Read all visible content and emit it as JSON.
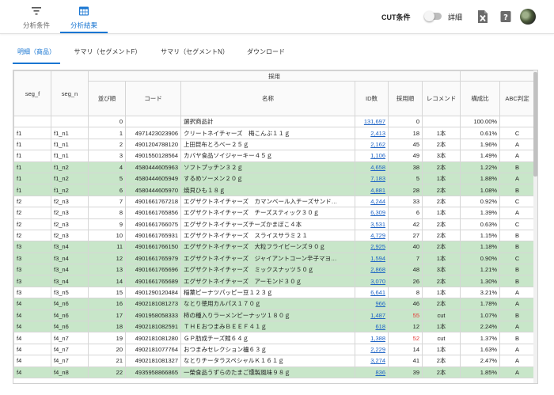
{
  "nav": {
    "cond_label": "分析条件",
    "result_label": "分析結果"
  },
  "header": {
    "cut_label": "CUT条件",
    "detail_label": "詳細"
  },
  "subtabs": [
    "明細（商品）",
    "サマリ（セグメントF）",
    "サマリ（セグメントN）",
    "ダウンロード"
  ],
  "table": {
    "group_header": "採用",
    "columns": [
      "seg_f",
      "seg_n",
      "並び順",
      "コード",
      "名称",
      "ID数",
      "採用順",
      "レコメンド",
      "構成比",
      "ABC判定"
    ],
    "rows": [
      {
        "seg_f": "",
        "seg_n": "",
        "order": "0",
        "code": "",
        "name": "選択商品計",
        "ids": "131,697",
        "rank": "0",
        "rec": "",
        "ratio": "100.00%",
        "abc": "",
        "green": false,
        "red_rank": false
      },
      {
        "seg_f": "f1",
        "seg_n": "f1_n1",
        "order": "1",
        "code": "4971423023906",
        "name": "クリートネイチャーズ　梅こんぶ１１ｇ",
        "ids": "2,413",
        "rank": "18",
        "rec": "1本",
        "ratio": "0.61%",
        "abc": "C",
        "green": false,
        "red_rank": false
      },
      {
        "seg_f": "f1",
        "seg_n": "f1_n1",
        "order": "2",
        "code": "4901204788120",
        "name": "上田昆布とろべー２５ｇ",
        "ids": "2,162",
        "rank": "45",
        "rec": "2本",
        "ratio": "1.96%",
        "abc": "A",
        "green": false,
        "red_rank": false
      },
      {
        "seg_f": "f1",
        "seg_n": "f1_n1",
        "order": "3",
        "code": "4901550128564",
        "name": "カバヤ食品ソイジャーキー４５ｇ",
        "ids": "1,106",
        "rank": "49",
        "rec": "3本",
        "ratio": "1.49%",
        "abc": "A",
        "green": false,
        "red_rank": false
      },
      {
        "seg_f": "f1",
        "seg_n": "f1_n2",
        "order": "4",
        "code": "4580444605963",
        "name": "ソフトプッチン３２ｇ",
        "ids": "4,658",
        "rank": "38",
        "rec": "2本",
        "ratio": "1.22%",
        "abc": "B",
        "green": true,
        "red_rank": false
      },
      {
        "seg_f": "f1",
        "seg_n": "f1_n2",
        "order": "5",
        "code": "4580444605949",
        "name": "するめソーメン２０ｇ",
        "ids": "7,183",
        "rank": "5",
        "rec": "1本",
        "ratio": "1.88%",
        "abc": "A",
        "green": true,
        "red_rank": false
      },
      {
        "seg_f": "f1",
        "seg_n": "f1_n2",
        "order": "6",
        "code": "4580444605970",
        "name": "焼貝ひも１８ｇ",
        "ids": "4,881",
        "rank": "28",
        "rec": "2本",
        "ratio": "1.08%",
        "abc": "B",
        "green": true,
        "red_rank": false
      },
      {
        "seg_f": "f2",
        "seg_n": "f2_n3",
        "order": "7",
        "code": "4901661767218",
        "name": "エグザクトネイチャーズ　カマンベール入チーズサンド…",
        "ids": "4,244",
        "rank": "33",
        "rec": "2本",
        "ratio": "0.92%",
        "abc": "C",
        "green": false,
        "red_rank": false
      },
      {
        "seg_f": "f2",
        "seg_n": "f2_n3",
        "order": "8",
        "code": "4901661765856",
        "name": "エグザクトネイチャーズ　チーズスティック３０ｇ",
        "ids": "6,309",
        "rank": "6",
        "rec": "1本",
        "ratio": "1.39%",
        "abc": "A",
        "green": false,
        "red_rank": false
      },
      {
        "seg_f": "f2",
        "seg_n": "f2_n3",
        "order": "9",
        "code": "4901661766075",
        "name": "エグザクトネイチャーズチーズかまぼこ４本",
        "ids": "3,531",
        "rank": "42",
        "rec": "2本",
        "ratio": "0.63%",
        "abc": "C",
        "green": false,
        "red_rank": false
      },
      {
        "seg_f": "f2",
        "seg_n": "f2_n3",
        "order": "10",
        "code": "4901661765931",
        "name": "エグザクトネイチャーズ　スライスサラミ２１",
        "ids": "4,729",
        "rank": "27",
        "rec": "2本",
        "ratio": "1.15%",
        "abc": "B",
        "green": false,
        "red_rank": false
      },
      {
        "seg_f": "f3",
        "seg_n": "f3_n4",
        "order": "11",
        "code": "4901661766150",
        "name": "エグザクトネイチャーズ　大粒フライビーンズ９０ｇ",
        "ids": "2,925",
        "rank": "40",
        "rec": "2本",
        "ratio": "1.18%",
        "abc": "B",
        "green": true,
        "red_rank": false
      },
      {
        "seg_f": "f3",
        "seg_n": "f3_n4",
        "order": "12",
        "code": "4901661765979",
        "name": "エグザクトネイチャーズ　ジャイアントコーン辛子マヨ…",
        "ids": "1,594",
        "rank": "7",
        "rec": "1本",
        "ratio": "0.90%",
        "abc": "C",
        "green": true,
        "red_rank": false
      },
      {
        "seg_f": "f3",
        "seg_n": "f3_n4",
        "order": "13",
        "code": "4901661765696",
        "name": "エグザクトネイチャーズ　ミックスナッツ５０ｇ",
        "ids": "2,868",
        "rank": "48",
        "rec": "3本",
        "ratio": "1.21%",
        "abc": "B",
        "green": true,
        "red_rank": false
      },
      {
        "seg_f": "f3",
        "seg_n": "f3_n4",
        "order": "14",
        "code": "4901661765689",
        "name": "エグザクトネイチャーズ　アーモンド３０ｇ",
        "ids": "3,070",
        "rank": "26",
        "rec": "2本",
        "ratio": "1.30%",
        "abc": "B",
        "green": true,
        "red_rank": false
      },
      {
        "seg_f": "f3",
        "seg_n": "f3_n5",
        "order": "15",
        "code": "4901290120484",
        "name": "稲葉ピーナツパッピー豆１２３ｇ",
        "ids": "6,641",
        "rank": "8",
        "rec": "1本",
        "ratio": "3.21%",
        "abc": "A",
        "green": false,
        "red_rank": false
      },
      {
        "seg_f": "f4",
        "seg_n": "f4_n6",
        "order": "16",
        "code": "4902181081273",
        "name": "なとり徳用カルパス１７０ｇ",
        "ids": "966",
        "rank": "46",
        "rec": "2本",
        "ratio": "1.78%",
        "abc": "A",
        "green": true,
        "red_rank": false
      },
      {
        "seg_f": "f4",
        "seg_n": "f4_n6",
        "order": "17",
        "code": "4901958058333",
        "name": "柿の種入りラーメンピーナッツ１８０ｇ",
        "ids": "1,487",
        "rank": "55",
        "rec": "cut",
        "ratio": "1.07%",
        "abc": "B",
        "green": true,
        "red_rank": true
      },
      {
        "seg_f": "f4",
        "seg_n": "f4_n6",
        "order": "18",
        "code": "4902181082591",
        "name": "ＴＨＥおつまみＢＥＥＦ４１ｇ",
        "ids": "618",
        "rank": "12",
        "rec": "1本",
        "ratio": "2.24%",
        "abc": "A",
        "green": true,
        "red_rank": false
      },
      {
        "seg_f": "f4",
        "seg_n": "f4_n7",
        "order": "19",
        "code": "4902181081280",
        "name": "ＧＰ肪成チーズ鱈６４ｇ",
        "ids": "1,388",
        "rank": "52",
        "rec": "cut",
        "ratio": "1.37%",
        "abc": "B",
        "green": false,
        "red_rank": true
      },
      {
        "seg_f": "f4",
        "seg_n": "f4_n7",
        "order": "20",
        "code": "4902181077764",
        "name": "おつまみセレクション櫨６３ｇ",
        "ids": "2,229",
        "rank": "14",
        "rec": "1本",
        "ratio": "1.63%",
        "abc": "A",
        "green": false,
        "red_rank": false
      },
      {
        "seg_f": "f4",
        "seg_n": "f4_n7",
        "order": "21",
        "code": "4902181081327",
        "name": "なとりチータラスペシャルＫ１６１ｇ",
        "ids": "3,274",
        "rank": "41",
        "rec": "2本",
        "ratio": "2.47%",
        "abc": "A",
        "green": false,
        "red_rank": false
      },
      {
        "seg_f": "f4",
        "seg_n": "f4_n8",
        "order": "22",
        "code": "4935958866865",
        "name": "一榮食品うずらのたまご燻製風味９８ｇ",
        "ids": "836",
        "rank": "39",
        "rec": "2本",
        "ratio": "1.85%",
        "abc": "A",
        "green": true,
        "red_rank": false
      }
    ]
  },
  "colors": {
    "accent": "#1976d2",
    "row_green": "#c8e6c9",
    "link": "#1e63c4",
    "warn": "#e53935"
  }
}
